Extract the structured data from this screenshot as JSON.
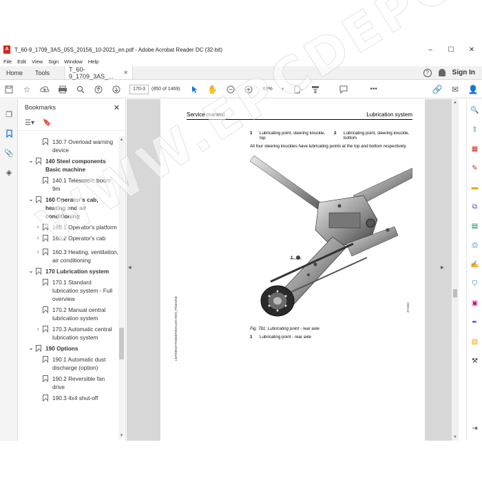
{
  "window": {
    "title": "T_60-9_1709_3AS_05S_20156_10-2021_en.pdf - Adobe Acrobat Reader DC (32-bit)",
    "minimize": "–",
    "maximize": "☐",
    "close": "✕"
  },
  "menu": [
    "File",
    "Edit",
    "View",
    "Sign",
    "Window",
    "Help"
  ],
  "tabs": {
    "home": "Home",
    "tools": "Tools",
    "document": "T_60-9_1709_3AS_...",
    "close": "✕",
    "sign_in": "Sign In"
  },
  "toolbar": {
    "page_input": "170-3",
    "page_count": "(850 of 1469)",
    "zoom": "69%"
  },
  "bookmarks": {
    "title": "Bookmarks",
    "items": [
      {
        "level": 2,
        "chevron": "",
        "label": "130.7 Overload warning device"
      },
      {
        "level": 1,
        "chevron": "⌄",
        "label": "140 Steel components Basic machine"
      },
      {
        "level": 2,
        "chevron": "",
        "label": "140.1 Telescopic boom 9m"
      },
      {
        "level": 1,
        "chevron": "⌄",
        "label": "160 Operator's cab, heating and air conditioning"
      },
      {
        "level": 2,
        "chevron": "›",
        "label": "160.1 Operator's platform"
      },
      {
        "level": 2,
        "chevron": "›",
        "label": "160.2 Operator's cab"
      },
      {
        "level": 2,
        "chevron": "›",
        "label": "160.3 Heating, ventilation, air conditioning"
      },
      {
        "level": 1,
        "chevron": "⌄",
        "label": "170 Lubrication system"
      },
      {
        "level": 2,
        "chevron": "",
        "label": "170.1 Standard lubrication system - Full overview"
      },
      {
        "level": 2,
        "chevron": "",
        "label": "170.2 Manual central lubrication system"
      },
      {
        "level": 2,
        "chevron": "›",
        "label": "170.3 Automatic central lubrication system"
      },
      {
        "level": 1,
        "chevron": "⌄",
        "label": "190 Options"
      },
      {
        "level": 2,
        "chevron": "",
        "label": "190.1 Automatic dust discharge (option)"
      },
      {
        "level": 2,
        "chevron": "",
        "label": "190.2 Reversible fan drive"
      },
      {
        "level": 2,
        "chevron": "",
        "label": "190.3 4x4 shut-off"
      }
    ]
  },
  "page": {
    "header_left": "Service manual",
    "header_right": "Lubrication system",
    "legend": [
      {
        "num": "1",
        "text": "Lubricating point, steering knuckle, top"
      },
      {
        "num": "2",
        "text": "Lubricating point, steering knuckle, bottom"
      }
    ],
    "note": "All four steering knuckles have lubricating points at the top and bottom respectively",
    "figure_callout": "1",
    "figure_code": "371563",
    "caption": "Fig. 781: Lubricating point - rear axle",
    "caption_legend": {
      "num": "1",
      "text": "Lubricating point - rear axle"
    },
    "side_code": "LMT/0001F/T/0960TW3AC0/1709S_F/NEN/SE"
  },
  "watermark": "WWW.EPCDEPO.COM",
  "colors": {
    "accent": "#1473e6",
    "app_red": "#d4261c",
    "doc_bg": "#d7d7d7"
  }
}
